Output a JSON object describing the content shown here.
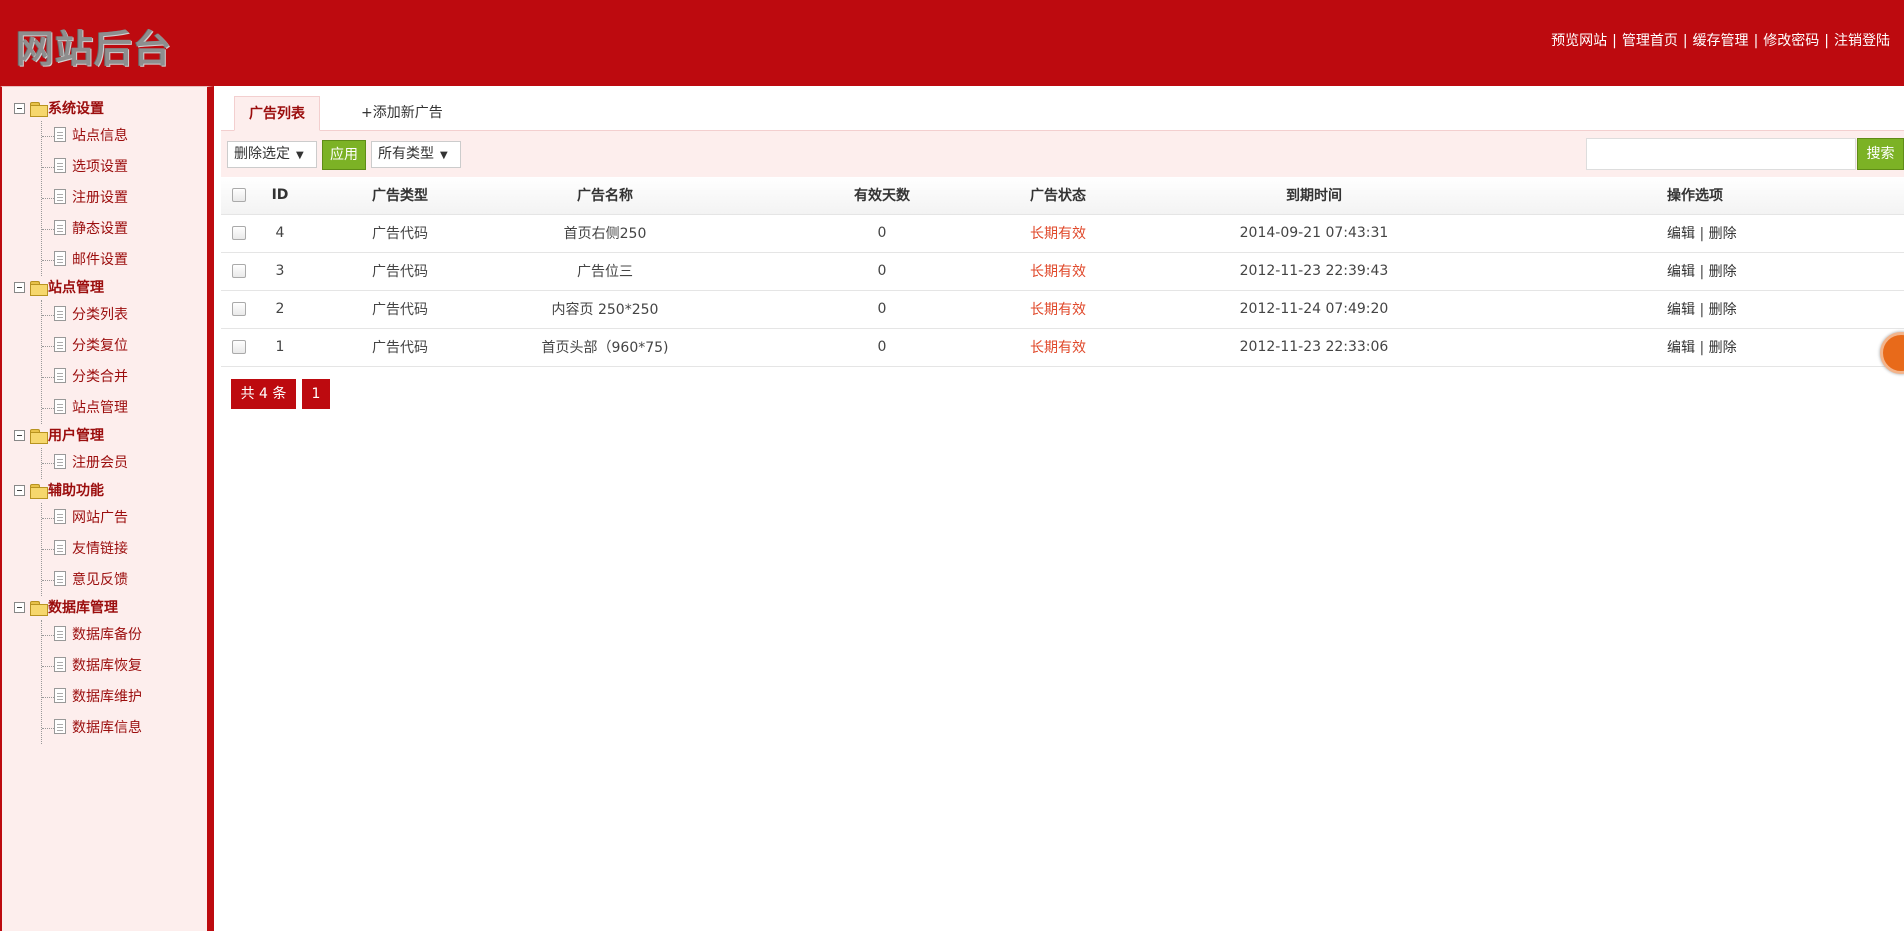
{
  "header": {
    "logo_text": "网站后台",
    "links": [
      "预览网站",
      "管理首页",
      "缓存管理",
      "修改密码",
      "注销登陆"
    ],
    "separator": "|"
  },
  "sidebar": {
    "groups": [
      {
        "title": "系统设置",
        "items": [
          "站点信息",
          "选项设置",
          "注册设置",
          "静态设置",
          "邮件设置"
        ]
      },
      {
        "title": "站点管理",
        "items": [
          "分类列表",
          "分类复位",
          "分类合并",
          "站点管理"
        ]
      },
      {
        "title": "用户管理",
        "items": [
          "注册会员"
        ]
      },
      {
        "title": "辅助功能",
        "items": [
          "网站广告",
          "友情链接",
          "意见反馈"
        ]
      },
      {
        "title": "数据库管理",
        "items": [
          "数据库备份",
          "数据库恢复",
          "数据库维护",
          "数据库信息"
        ]
      }
    ]
  },
  "tabs": {
    "list": "广告列表",
    "add": "+添加新广告"
  },
  "toolbar": {
    "action_select": "删除选定",
    "apply": "应用",
    "type_select": "所有类型",
    "search_value": "",
    "search": "搜索"
  },
  "table": {
    "headers": [
      "ID",
      "广告类型",
      "广告名称",
      "有效天数",
      "广告状态",
      "到期时间",
      "操作选项"
    ],
    "rows": [
      {
        "id": "4",
        "type": "广告代码",
        "name": "首页右侧250",
        "days": "0",
        "status": "长期有效",
        "expire": "2014-09-21 07:43:31"
      },
      {
        "id": "3",
        "type": "广告代码",
        "name": "广告位三",
        "days": "0",
        "status": "长期有效",
        "expire": "2012-11-23 22:39:43"
      },
      {
        "id": "2",
        "type": "广告代码",
        "name": "内容页 250*250",
        "days": "0",
        "status": "长期有效",
        "expire": "2012-11-24 07:49:20"
      },
      {
        "id": "1",
        "type": "广告代码",
        "name": "首页头部（960*75)",
        "days": "0",
        "status": "长期有效",
        "expire": "2012-11-23 22:33:06"
      }
    ],
    "edit": "编辑",
    "delete": "删除",
    "op_sep": "|"
  },
  "pager": {
    "total": "共 4 条",
    "page": "1"
  },
  "colors": {
    "brand_red": "#bd0a0f",
    "sidebar_bg": "#fdeeed",
    "green": "#7cb225",
    "status_orange": "#e0482a"
  }
}
